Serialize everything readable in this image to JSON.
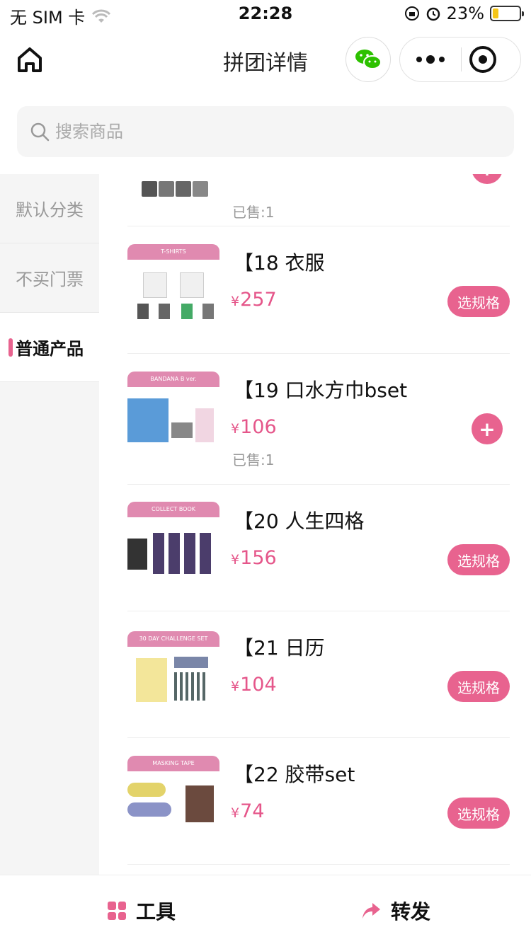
{
  "status_bar": {
    "carrier": "无 SIM 卡",
    "time": "22:28",
    "battery": "23%",
    "battery_level": 0.23
  },
  "header": {
    "title": "拼团详情"
  },
  "search": {
    "placeholder": "搜索商品"
  },
  "sidebar": {
    "items": [
      {
        "label": "默认分类"
      },
      {
        "label": "不买门票"
      },
      {
        "label": "普通产品"
      }
    ]
  },
  "products": [
    {
      "name": "",
      "price": "",
      "sold": "已售:1",
      "action": "add",
      "thumb_label": ""
    },
    {
      "name": "【18 衣服",
      "price": "257",
      "sold": "",
      "action": "选规格",
      "thumb_label": "T-SHIRTS"
    },
    {
      "name": "【19 口水方巾bset",
      "price": "106",
      "sold": "已售:1",
      "action": "add",
      "thumb_label": "BANDANA B ver."
    },
    {
      "name": "【20 人生四格",
      "price": "156",
      "sold": "",
      "action": "选规格",
      "thumb_label": "COLLECT BOOK"
    },
    {
      "name": "【21 日历",
      "price": "104",
      "sold": "",
      "action": "选规格",
      "thumb_label": "30 DAY CHALLENGE SET"
    },
    {
      "name": "【22 胶带set",
      "price": "74",
      "sold": "",
      "action": "选规格",
      "thumb_label": "MASKING TAPE"
    }
  ],
  "currency": "¥",
  "bottom_bar": {
    "tools": "工具",
    "share": "转发"
  },
  "colors": {
    "accent": "#e8638f",
    "price": "#e5568a",
    "wechat": "#2dc100"
  }
}
